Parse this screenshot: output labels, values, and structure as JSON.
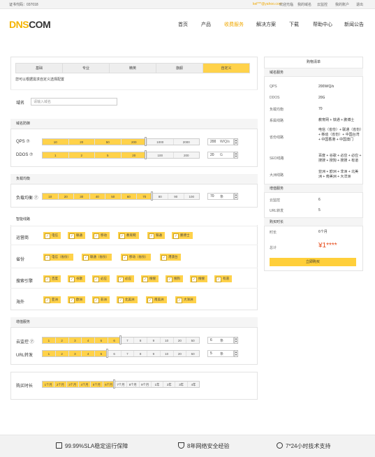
{
  "topbar": {
    "cert": "证书代码：037018",
    "email": "kel***@yahoo.com",
    "links": [
      "欢迎光临",
      "我的域名",
      "云监控",
      "我的账户",
      "退出"
    ]
  },
  "logo": {
    "a": "DNS",
    "b": "COM"
  },
  "nav": [
    "首页",
    "产品",
    "收费服务",
    "解决方案",
    "下载",
    "帮助中心",
    "新闻公告"
  ],
  "tabs": [
    "基础",
    "专业",
    "精英",
    "旗舰",
    "自定义"
  ],
  "hint": "您可以根据需求自定义选择配置",
  "domain": {
    "label": "域名",
    "placeholder": "请输入域名"
  },
  "defense": {
    "title": "域名防御",
    "qps": {
      "label": "QPS ⑦",
      "ticks": [
        "10",
        "20",
        "50",
        "200",
        "1000",
        "2000"
      ],
      "value": "200",
      "unit": "W/Q/s"
    },
    "ddos": {
      "label": "DDOS ⑦",
      "ticks": [
        "1",
        "2",
        "5",
        "20",
        "100",
        "200"
      ],
      "value": "20",
      "unit": "G"
    }
  },
  "balance": {
    "title": "负载均衡",
    "label": "负载均衡 ⑦",
    "ticks": [
      "10",
      "20",
      "30",
      "40",
      "50",
      "60",
      "70",
      "80",
      "90",
      "100"
    ],
    "value": "70",
    "unit": "条"
  },
  "lines": {
    "title": "智能线路",
    "carrier": {
      "label": "运营商",
      "items": [
        "电信",
        "联通",
        "移动",
        "教育网",
        "铁通",
        "鹏博士"
      ]
    },
    "province": {
      "label": "省份",
      "items": [
        "电信（省份）",
        "联通（省份）",
        "移动（省份）",
        "港澳台"
      ]
    },
    "search": {
      "label": "搜索引擎",
      "items": [
        "百度",
        "谷歌",
        "必应",
        "必应",
        "搜搜",
        "搜狗",
        "搜搜",
        "有道"
      ]
    },
    "overseas": {
      "label": "海外",
      "items": [
        "亚洲",
        "欧洲",
        "非洲",
        "北美洲",
        "南美洲",
        "大洋洲"
      ]
    }
  },
  "vas": {
    "title": "增值服务",
    "monitor": {
      "label": "云监控 ⑦",
      "ticks": [
        "1",
        "2",
        "3",
        "4",
        "5",
        "6",
        "7",
        "8",
        "9",
        "10",
        "20",
        "50"
      ],
      "value": "6",
      "unit": "条"
    },
    "url": {
      "label": "URL转发",
      "ticks": [
        "1",
        "2",
        "3",
        "4",
        "5",
        "6",
        "7",
        "8",
        "9",
        "10",
        "20",
        "50"
      ],
      "value": "5",
      "unit": "条"
    }
  },
  "period": {
    "label": "购买时长",
    "items": [
      "1个月",
      "2个月",
      "3个月",
      "4个月",
      "5个月",
      "6个月",
      "7个月",
      "8个月",
      "9个月",
      "1年",
      "2年",
      "3年",
      "4年"
    ]
  },
  "cart": {
    "title": "购物清单",
    "service_head": "域名服务",
    "rows": [
      [
        "QPS",
        "200W/Q/s"
      ],
      [
        "DDOS",
        "20G"
      ],
      [
        "负载均衡",
        "70"
      ],
      [
        "系属线路",
        "教育网 + 铁通 + 鹏博士"
      ],
      [
        "省份线路",
        "电信（省份）+ 联通（省份）+ 移动（省份）+ 中国台湾 + 中国香港 + 中国澳门"
      ],
      [
        "SEO线路",
        "百度 + 谷歌 + 必应 + 必应 + 搜搜 + 搜狗 + 搜搜 + 有道"
      ],
      [
        "大洲线路",
        "亚洲 + 欧洲 + 非洲 + 北美洲 + 南美洲 + 大洋洲"
      ]
    ],
    "vas_head": "增值服务",
    "vas_rows": [
      [
        "云监控",
        "6"
      ],
      [
        "URL转发",
        "5"
      ]
    ],
    "time_head": "购买时长",
    "time_label": "时长",
    "time_value": "6个月",
    "total_label": "总计",
    "total_value": "¥1****",
    "buy": "立即购买"
  },
  "footer": [
    "99.99%SLA稳定运行保障",
    "8年网络安全经验",
    "7*24小时技术支持"
  ]
}
